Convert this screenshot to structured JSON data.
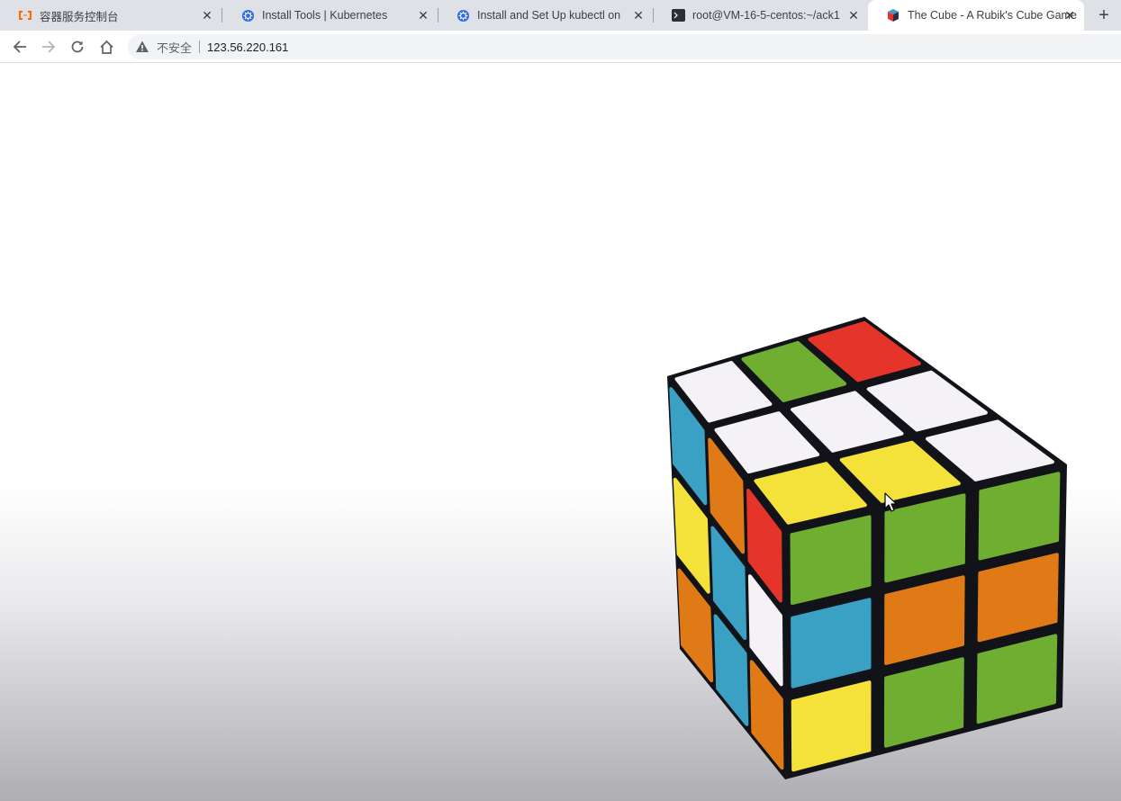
{
  "tabs": [
    {
      "title": "容器服务控制台",
      "icon": "aliyun-icon",
      "active": false
    },
    {
      "title": "Install Tools | Kubernetes",
      "icon": "kubernetes-icon",
      "active": false
    },
    {
      "title": "Install and Set Up kubectl on Linux",
      "icon": "kubernetes-icon",
      "active": false
    },
    {
      "title": "root@VM-16-5-centos:~/ack1",
      "icon": "terminal-icon",
      "active": false
    },
    {
      "title": "The Cube - A Rubik's Cube Game",
      "icon": "rubiks-cube-icon",
      "active": true
    }
  ],
  "toolbar": {
    "back_icon": "arrow-left-icon",
    "forward_icon": "arrow-right-icon",
    "reload_icon": "reload-icon",
    "home_icon": "home-icon",
    "security_label": "不安全",
    "url": "123.56.220.161"
  },
  "game": {
    "name": "The Cube",
    "colors": {
      "white": "#f4f2f6",
      "green": "#6fae31",
      "red": "#e5352b",
      "yellow": "#f4e23a",
      "orange": "#df7a17",
      "blue": "#3aa0c4",
      "body": "#111318"
    },
    "top_face": [
      [
        "white",
        "green",
        "red"
      ],
      [
        "white",
        "white",
        "white"
      ],
      [
        "yellow",
        "yellow",
        "white"
      ]
    ],
    "front_face": [
      [
        "green",
        "green",
        "green"
      ],
      [
        "blue",
        "orange",
        "orange"
      ],
      [
        "yellow",
        "green",
        "green"
      ]
    ],
    "left_face": [
      [
        "blue",
        "orange",
        "red"
      ],
      [
        "yellow",
        "blue",
        "white"
      ],
      [
        "orange",
        "blue",
        "orange"
      ]
    ]
  }
}
